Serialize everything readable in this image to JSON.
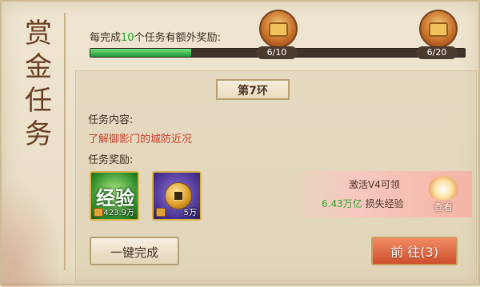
{
  "title": [
    "赏",
    "金",
    "任",
    "务"
  ],
  "progress": {
    "label_prefix": "每完成",
    "label_count": "10",
    "label_suffix": "个任务有额外奖励:",
    "fraction": 0.27,
    "chests": [
      {
        "count": "6/10"
      },
      {
        "count": "6/20"
      }
    ]
  },
  "task": {
    "round": "第7环",
    "content_label": "任务内容:",
    "content": "了解御影门的城防近况",
    "reward_label": "任务奖励:",
    "rewards": [
      {
        "name": "经验",
        "amount": "423.9万"
      },
      {
        "name": "coin",
        "amount": "5万"
      }
    ]
  },
  "promo": {
    "line1": "激活V4可领",
    "amount": "6.43万亿",
    "line2_suffix": "损失经验",
    "view_label": "查看"
  },
  "buttons": {
    "complete_all": "一键完成",
    "go": "前 往(3)"
  },
  "colors": {
    "accent_green": "#2aa62e",
    "content_red": "#c9412c",
    "go_button": "#cf4f2d"
  },
  "icons": [
    "treasure-chest-icon",
    "experience-icon",
    "coin-icon",
    "lock-icon",
    "lotus-icon"
  ]
}
